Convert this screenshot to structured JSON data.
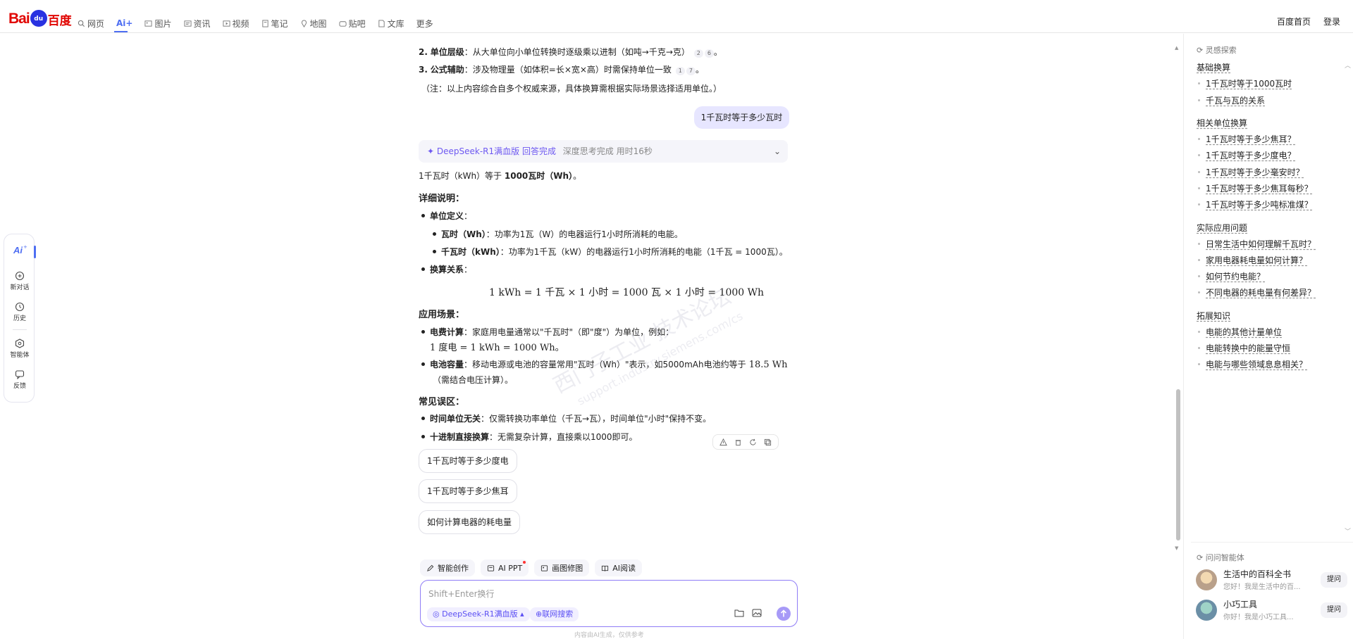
{
  "header": {
    "logo_text_left": "Bai",
    "logo_paw": "du",
    "logo_text_right": "百度",
    "nav": [
      {
        "label": "网页",
        "icon": "search-icon"
      },
      {
        "label": "Ai+",
        "icon": "",
        "active": true
      },
      {
        "label": "图片",
        "icon": "image-icon"
      },
      {
        "label": "资讯",
        "icon": "news-icon"
      },
      {
        "label": "视频",
        "icon": "video-icon"
      },
      {
        "label": "笔记",
        "icon": "note-icon"
      },
      {
        "label": "地图",
        "icon": "map-icon"
      },
      {
        "label": "贴吧",
        "icon": "tieba-icon"
      },
      {
        "label": "文库",
        "icon": "doc-icon"
      },
      {
        "label": "更多",
        "icon": ""
      }
    ],
    "home_link": "百度首页",
    "login": "登录"
  },
  "sidebar": {
    "items": [
      {
        "label": "",
        "icon": "ai-icon"
      },
      {
        "label": "新对话",
        "icon": "new-chat-icon"
      },
      {
        "label": "历史",
        "icon": "history-icon"
      },
      {
        "label": "智能体",
        "icon": "agent-icon"
      },
      {
        "label": "反馈",
        "icon": "feedback-icon"
      }
    ]
  },
  "prev_answer": {
    "line1_num": "2.",
    "line1_bold": "单位层级",
    "line1_text": "：从大单位向小单位转换时逐级乘以进制（如吨→千克→克）",
    "line1_refs": [
      "2",
      "6"
    ],
    "line1_end": "。",
    "line2_num": "3.",
    "line2_bold": "公式辅助",
    "line2_text": "：涉及物理量（如体积=长×宽×高）时需保持单位一致",
    "line2_refs": [
      "1",
      "7"
    ],
    "line2_end": "。",
    "note": "（注：以上内容综合自多个权威来源，具体换算需根据实际场景选择适用单位。）"
  },
  "user_question": "1千瓦时等于多少瓦时",
  "think_bar": {
    "model": "DeepSeek-R1满血版 回答完成",
    "status": "深度思考完成 用时16秒"
  },
  "answer": {
    "lead_a": "1千瓦时（kWh）等于 ",
    "lead_b": "1000瓦时（Wh）",
    "lead_c": "。",
    "detail_heading": "详细说明：",
    "unit_def_label": "单位定义",
    "unit_def_colon": "：",
    "wh_label": "瓦时（Wh）",
    "wh_text": "：功率为1瓦（W）的电器运行1小时所消耗的电能。",
    "kwh_label": "千瓦时（kWh）",
    "kwh_text": "：功率为1千瓦（kW）的电器运行1小时所消耗的电能（1千瓦 = 1000瓦）。",
    "conv_label": "换算关系",
    "conv_colon": "：",
    "formula": "1 kWh = 1 千瓦 × 1 小时 = 1000 瓦 × 1 小时 = 1000 Wh",
    "scenario_heading": "应用场景：",
    "fee_label": "电费计算",
    "fee_text": "：家庭用电量通常以\"千瓦时\"（即\"度\"）为单位，例如：",
    "fee_formula": "1 度电 = 1 kWh = 1000 Wh。",
    "battery_label": "电池容量",
    "battery_text": "：移动电源或电池的容量常用\"瓦时（Wh）\"表示，如5000mAh电池约等于",
    "battery_val": " 18.5 Wh",
    "battery_text2": "（需结合电压计算）。",
    "mistake_heading": "常见误区：",
    "time_label": "时间单位无关",
    "time_text": "：仅需转换功率单位（千瓦→瓦），时间单位\"小时\"保持不变。",
    "decimal_label": "十进制直接换算",
    "decimal_text": "：无需复杂计算，直接乘以1000即可。"
  },
  "suggestions": [
    "1千瓦时等于多少度电",
    "1千瓦时等于多少焦耳",
    "如何计算电器的耗电量"
  ],
  "tools": [
    {
      "label": "智能创作",
      "icon": "pen-icon"
    },
    {
      "label": "AI PPT",
      "icon": "ppt-icon"
    },
    {
      "label": "画图修图",
      "icon": "picture-icon"
    },
    {
      "label": "AI阅读",
      "icon": "book-icon"
    }
  ],
  "input": {
    "placeholder": "Shift+Enter换行",
    "model": "DeepSeek-R1满血版",
    "web": "联网搜索"
  },
  "disclaimer": "内容由AI生成，仅供参考",
  "explore": {
    "title": "灵感探索",
    "sections": [
      {
        "title": "基础换算",
        "items": [
          "1千瓦时等于1000瓦时",
          "千瓦与瓦的关系"
        ]
      },
      {
        "title": "相关单位换算",
        "items": [
          "1千瓦时等于多少焦耳？",
          "1千瓦时等于多少度电？",
          "1千瓦时等于多少毫安时？",
          "1千瓦时等于多少焦耳每秒？",
          "1千瓦时等于多少吨标准煤？"
        ]
      },
      {
        "title": "实际应用问题",
        "items": [
          "日常生活中如何理解千瓦时？",
          "家用电器耗电量如何计算？",
          "如何节约电能？",
          "不同电器的耗电量有何差异？"
        ]
      },
      {
        "title": "拓展知识",
        "items": [
          "电能的其他计量单位",
          "电能转换中的能量守恒",
          "电能与哪些领域息息相关？"
        ]
      }
    ]
  },
  "agents": {
    "title": "问问智能体",
    "list": [
      {
        "name": "生活中的百科全书",
        "desc": "您好！我是生活中的百...",
        "ask": "提问"
      },
      {
        "name": "小巧工具",
        "desc": "你好！我是小巧工具...",
        "ask": "提问"
      }
    ]
  },
  "watermark": {
    "line1": "西门子工业 技术论坛",
    "line2": "support.industry.siemens.com/cs"
  },
  "colors": {
    "accent": "#4e6ef2",
    "purple": "#6e59f1",
    "baidu_red": "#e10602",
    "baidu_blue": "#2932e1"
  }
}
